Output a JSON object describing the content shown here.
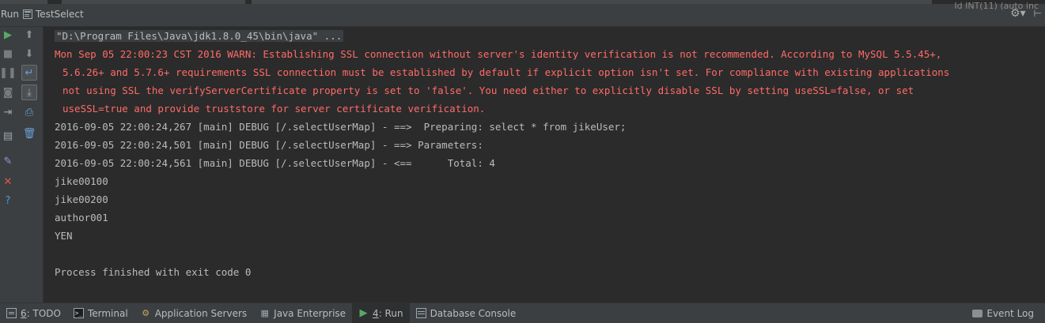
{
  "header": {
    "panel_label": "Run",
    "tab_label": "TestSelect",
    "clipped_right_text": "Id INT(11) (auto inc",
    "gear_icon": "gear-icon",
    "pin_icon": "pin-icon"
  },
  "sidebar": {
    "left_buttons": [
      {
        "name": "rerun-icon",
        "glyph": "▶",
        "color": "#59a869"
      },
      {
        "name": "stop-icon",
        "glyph": "■",
        "color": "#7a7a7a"
      },
      {
        "name": "pause-icon",
        "glyph": "❚❚",
        "color": "#7a7a7a"
      },
      {
        "name": "dump-threads-icon",
        "glyph": "◙",
        "color": "#7a7a7a"
      },
      {
        "name": "exit-icon",
        "glyph": "⇥",
        "color": "#9aa7b0"
      },
      {
        "name": "restore-layout-icon",
        "glyph": "▤",
        "color": "#9aa7b0"
      },
      {
        "name": "pin-tab-icon",
        "glyph": "✎",
        "color": "#a58ecf"
      },
      {
        "name": "close-icon",
        "glyph": "✕",
        "color": "#e0584d"
      },
      {
        "name": "help-icon",
        "glyph": "?",
        "color": "#4a9ad4"
      }
    ],
    "right_buttons": [
      {
        "name": "up-stack-icon",
        "glyph": "⬆",
        "color": "#8a8f93"
      },
      {
        "name": "down-stack-icon",
        "glyph": "⬇",
        "color": "#8a8f93"
      },
      {
        "name": "soft-wrap-icon",
        "glyph": "↵",
        "color": "#6ba0d6"
      },
      {
        "name": "scroll-to-end-icon",
        "glyph": "⤓",
        "color": "#9aa7b0"
      },
      {
        "name": "print-icon",
        "glyph": "⎙",
        "color": "#6ba0d6"
      },
      {
        "name": "clear-all-icon",
        "glyph": "🗑",
        "color": "#6ba0d6"
      }
    ]
  },
  "console": {
    "command": "\"D:\\Program Files\\Java\\jdk1.8.0_45\\bin\\java\" ...",
    "warning_lines": [
      "Mon Sep 05 22:00:23 CST 2016 WARN: Establishing SSL connection without server's identity verification is not recommended. According to MySQL 5.5.45+,",
      "5.6.26+ and 5.7.6+ requirements SSL connection must be established by default if explicit option isn't set. For compliance with existing applications",
      "not using SSL the verifyServerCertificate property is set to 'false'. You need either to explicitly disable SSL by setting useSSL=false, or set",
      "useSSL=true and provide truststore for server certificate verification."
    ],
    "log_lines": [
      "2016-09-05 22:00:24,267 [main] DEBUG [/.selectUserMap] - ==>  Preparing: select * from jikeUser;",
      "2016-09-05 22:00:24,501 [main] DEBUG [/.selectUserMap] - ==> Parameters: ",
      "2016-09-05 22:00:24,561 [main] DEBUG [/.selectUserMap] - <==      Total: 4",
      "jike00100",
      "jike00200",
      "author001",
      "YEN",
      "",
      "Process finished with exit code 0"
    ]
  },
  "bottombar": {
    "todo_prefix": "6",
    "todo_label": ": TODO",
    "terminal_label": "Terminal",
    "app_servers_label": "Application Servers",
    "java_enterprise_label": "Java Enterprise",
    "run_prefix": "4",
    "run_label": ": Run",
    "db_console_label": "Database Console",
    "event_log_label": "Event Log"
  }
}
